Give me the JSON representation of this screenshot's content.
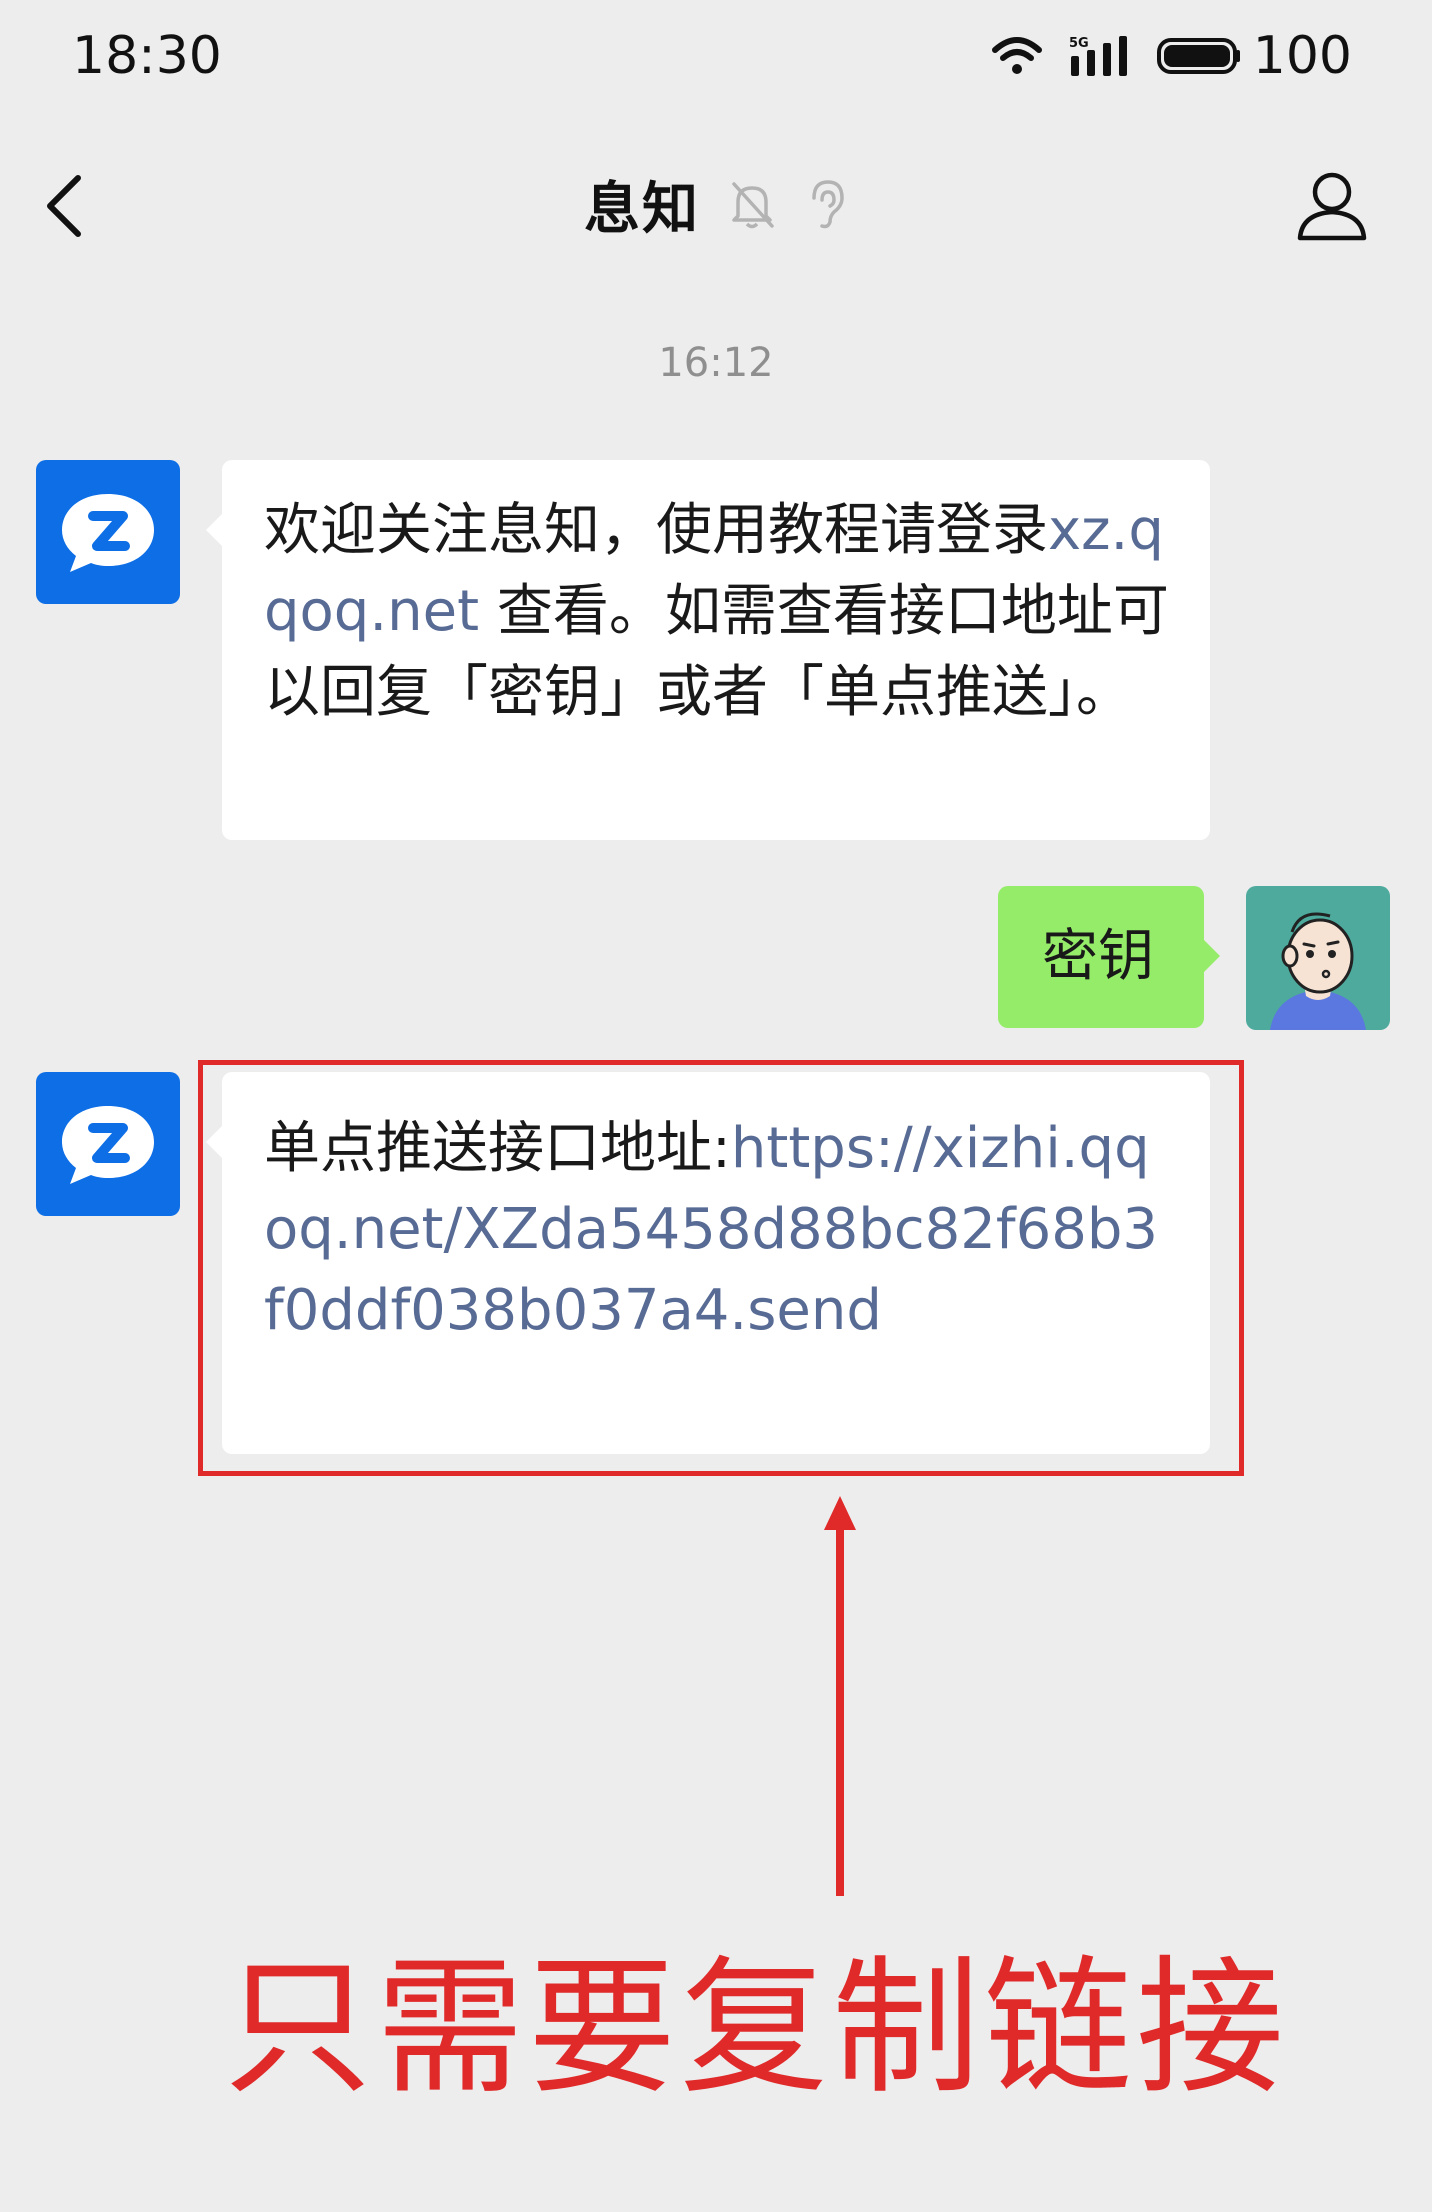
{
  "status_bar": {
    "time": "18:30",
    "battery": "100",
    "network_label": "5G",
    "icons": [
      "wifi-icon",
      "signal-icon",
      "battery-icon"
    ]
  },
  "nav": {
    "back_icon": "chevron-left-icon",
    "title": "息知",
    "title_icons": [
      "mute-bell-icon",
      "ear-icon"
    ],
    "profile_icon": "profile-icon"
  },
  "chat": {
    "timestamp": "16:12",
    "messages": [
      {
        "sender": "bot",
        "text_before": "欢迎关注息知，使用教程请登录",
        "link": "xz.qqoq.net",
        "text_after": " 查看。如需查看接口地址可以回复「密钥」或者「单点推送」。"
      },
      {
        "sender": "user",
        "text": "密钥"
      },
      {
        "sender": "bot",
        "label": "单点推送接口地址:",
        "link": "https://xizhi.qqoq.net/XZda5458d88bc82f68b3f0ddf038b037a4.send"
      }
    ]
  },
  "annotation": {
    "text": "只需要复制链接",
    "color": "#e02a2a"
  },
  "colors": {
    "background": "#ededed",
    "bubble_in": "#ffffff",
    "bubble_out": "#95ec69",
    "link": "#576b95",
    "bot_avatar": "#0d6ee6",
    "user_avatar": "#4daa9d"
  }
}
